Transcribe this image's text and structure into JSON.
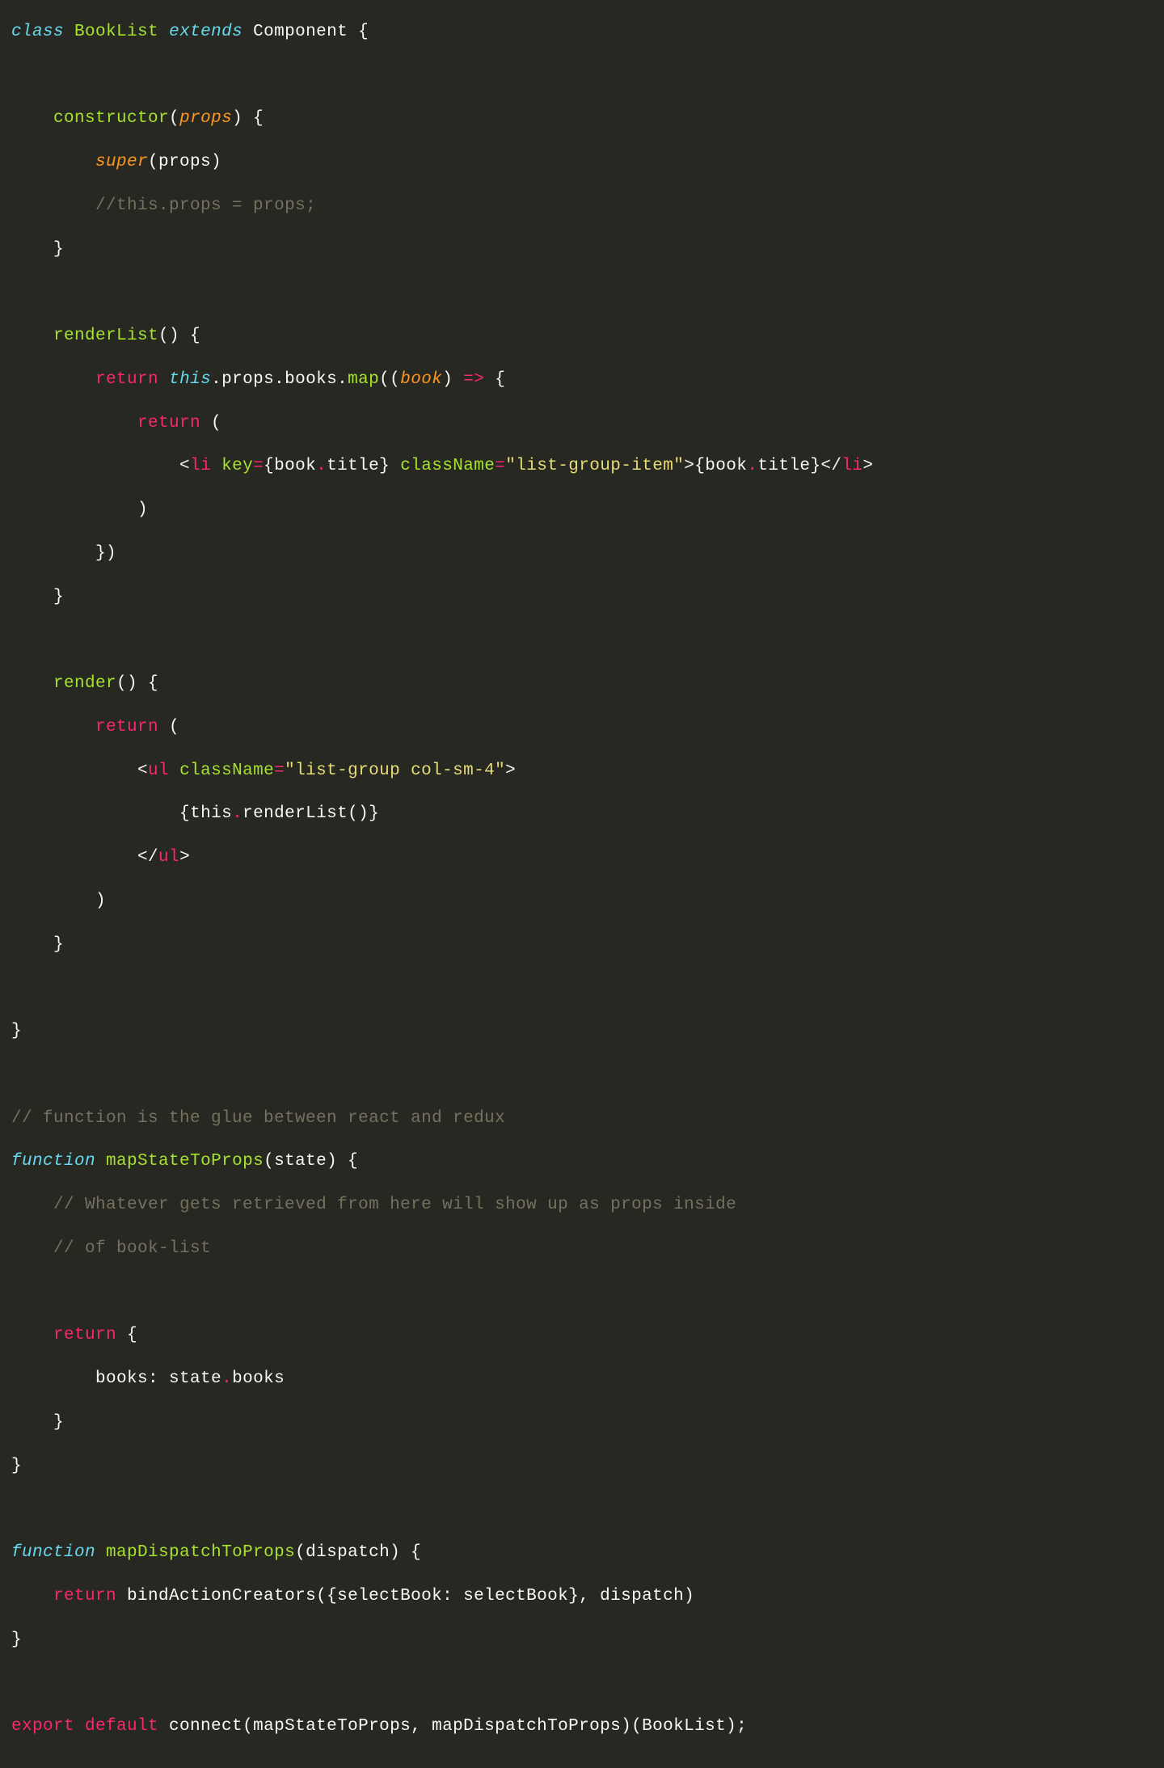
{
  "code": {
    "l1": {
      "class": "class",
      "name": "BookList",
      "extends": "extends",
      "comp": "Component",
      "open": " {"
    },
    "l3": {
      "ctor": "constructor",
      "open": "(",
      "param": "props",
      "close": ") {"
    },
    "l4": {
      "super": "super",
      "args": "(props)"
    },
    "l5": {
      "comment": "//this.props = props;"
    },
    "l6": {
      "close": "}"
    },
    "l8": {
      "name": "renderList",
      "rest": "() {"
    },
    "l9": {
      "ret": "return",
      "this": "this",
      "d1": ".",
      "p": "props",
      "d2": ".",
      "b": "books",
      "d3": ".",
      "map": "map",
      "open": "((",
      "param": "book",
      "mid": ") ",
      "arrow": "=>",
      "end": " {"
    },
    "l10": {
      "ret": "return",
      "paren": " ("
    },
    "l11": {
      "open": "<",
      "tag": "li",
      "sp": " ",
      "key": "key",
      "eq1": "=",
      "keyv_open": "{book",
      "keyv_dot": ".",
      "keyv_close": "title}",
      "sp2": " ",
      "cls": "className",
      "eq2": "=",
      "str": "\"list-group-item\"",
      "gt": ">",
      "body_open": "{book",
      "body_dot": ".",
      "body_close": "title}",
      "close1": "</",
      "tag2": "li",
      "gt2": ">"
    },
    "l12": {
      "close": ")"
    },
    "l13": {
      "close": "})"
    },
    "l14": {
      "close": "}"
    },
    "l16": {
      "name": "render",
      "rest": "() {"
    },
    "l17": {
      "ret": "return",
      "paren": " ("
    },
    "l18": {
      "open": "<",
      "tag": "ul",
      "sp": " ",
      "cls": "className",
      "eq": "=",
      "str": "\"list-group col-sm-4\"",
      "gt": ">"
    },
    "l19": {
      "open": "{",
      "this": "this",
      "dot": ".",
      "fn": "renderList()",
      "close": "}"
    },
    "l20": {
      "open": "</",
      "tag": "ul",
      "gt": ">"
    },
    "l21": {
      "close": ")"
    },
    "l22": {
      "close": "}"
    },
    "l24": {
      "close": "}"
    },
    "l26": {
      "comment": "// function is the glue between react and redux"
    },
    "l27": {
      "fn": "function",
      "name": "mapStateToProps",
      "rest": "(state) {"
    },
    "l28": {
      "comment": "// Whatever gets retrieved from here will show up as props inside"
    },
    "l29": {
      "comment": "// of book-list"
    },
    "l31": {
      "ret": "return",
      "open": " {"
    },
    "l32": {
      "key": "books: state",
      "dot": ".",
      "val": "books"
    },
    "l33": {
      "close": "}"
    },
    "l34": {
      "close": "}"
    },
    "l36": {
      "fn": "function",
      "name": "mapDispatchToProps",
      "rest": "(dispatch) {"
    },
    "l37": {
      "ret": "return",
      "call": " bindActionCreators({selectBook: selectBook}, dispatch)"
    },
    "l38": {
      "close": "}"
    },
    "l40": {
      "exp": "export",
      "def": "default",
      "rest": " connect(mapStateToProps, mapDispatchToProps)(BookList);"
    }
  }
}
